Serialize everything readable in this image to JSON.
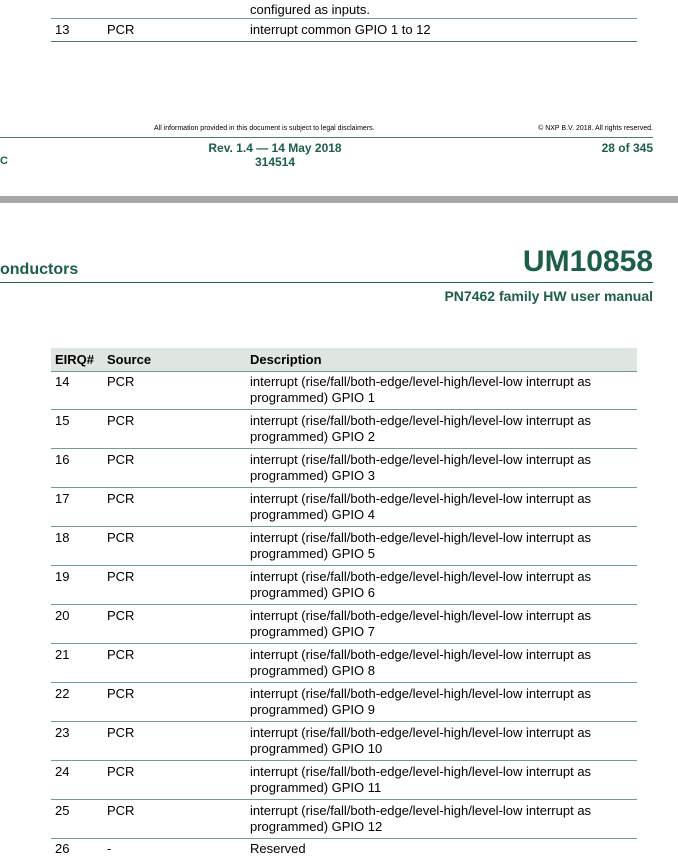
{
  "previous_page": {
    "continued_text": "configured as inputs.",
    "last_row": {
      "eirq": "13",
      "source": "PCR",
      "description": "interrupt common GPIO 1 to 12"
    },
    "footer": {
      "disclaimer": "All information provided in this document is subject to legal disclaimers.",
      "copyright": "© NXP B.V. 2018. All rights reserved.",
      "left_label": "C",
      "revision": "Rev. 1.4 — 14 May 2018",
      "doc_number": "314514",
      "page": "28 of 345"
    }
  },
  "header": {
    "company_fragment": "onductors",
    "doc_id": "UM10858",
    "subtitle": "PN7462 family HW user manual"
  },
  "table": {
    "columns": [
      "EIRQ#",
      "Source",
      "Description"
    ],
    "rows": [
      {
        "eirq": "14",
        "source": "PCR",
        "description": "interrupt (rise/fall/both-edge/level-high/level-low interrupt as programmed) GPIO 1"
      },
      {
        "eirq": "15",
        "source": "PCR",
        "description": "interrupt (rise/fall/both-edge/level-high/level-low interrupt as programmed) GPIO 2"
      },
      {
        "eirq": "16",
        "source": "PCR",
        "description": "interrupt (rise/fall/both-edge/level-high/level-low interrupt as programmed) GPIO 3"
      },
      {
        "eirq": "17",
        "source": "PCR",
        "description": "interrupt (rise/fall/both-edge/level-high/level-low interrupt as programmed) GPIO 4"
      },
      {
        "eirq": "18",
        "source": "PCR",
        "description": "interrupt (rise/fall/both-edge/level-high/level-low interrupt as programmed) GPIO 5"
      },
      {
        "eirq": "19",
        "source": "PCR",
        "description": "interrupt (rise/fall/both-edge/level-high/level-low interrupt as programmed) GPIO 6"
      },
      {
        "eirq": "20",
        "source": "PCR",
        "description": "interrupt (rise/fall/both-edge/level-high/level-low interrupt as programmed) GPIO 7"
      },
      {
        "eirq": "21",
        "source": "PCR",
        "description": "interrupt (rise/fall/both-edge/level-high/level-low interrupt as programmed) GPIO 8"
      },
      {
        "eirq": "22",
        "source": "PCR",
        "description": "interrupt (rise/fall/both-edge/level-high/level-low interrupt as programmed) GPIO 9"
      },
      {
        "eirq": "23",
        "source": "PCR",
        "description": "interrupt (rise/fall/both-edge/level-high/level-low interrupt as programmed) GPIO 10"
      },
      {
        "eirq": "24",
        "source": "PCR",
        "description": "interrupt (rise/fall/both-edge/level-high/level-low interrupt as programmed) GPIO 11"
      },
      {
        "eirq": "25",
        "source": "PCR",
        "description": "interrupt (rise/fall/both-edge/level-high/level-low interrupt as programmed) GPIO 12"
      },
      {
        "eirq": "26",
        "source": "-",
        "description": "Reserved"
      }
    ]
  },
  "colors": {
    "brand_green": "#1d5e46",
    "rule_green": "#6fa089",
    "header_fill": "#dfe6e1",
    "page_gap": "#a6a6a6"
  }
}
